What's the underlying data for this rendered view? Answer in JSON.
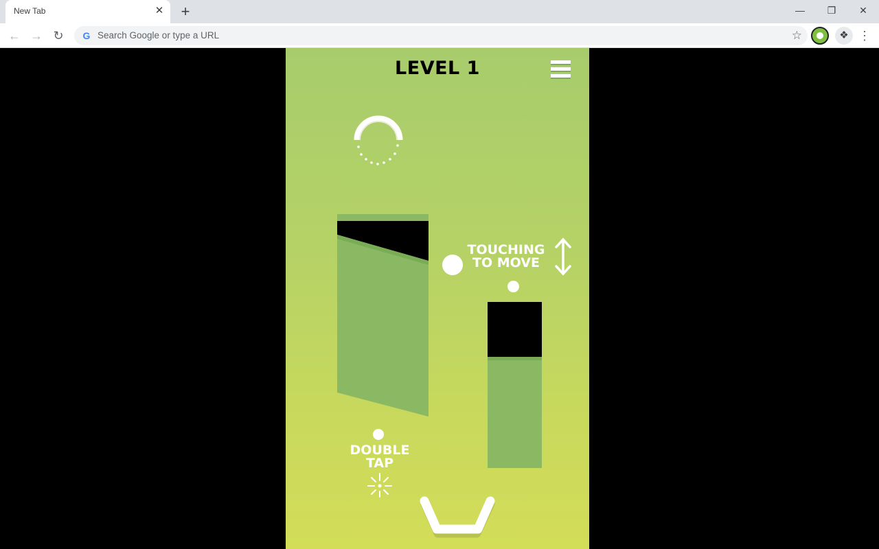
{
  "browser": {
    "tab_title": "New Tab",
    "tab_close": "✕",
    "new_tab": "+",
    "omnibox_placeholder": "Search Google or type a URL",
    "icons": [
      "back-icon",
      "forward-icon",
      "reload-icon",
      "google-icon",
      "star-icon",
      "extension-icon",
      "puzzle-icon",
      "menu-icon"
    ]
  },
  "game": {
    "level_title": "LEVEL 1",
    "hint_move_line1": "TOUCHING",
    "hint_move_line2": "TO MOVE",
    "hint_tap_line1": "DOUBLE",
    "hint_tap_line2": "TAP",
    "colors": {
      "bg_top": "#a8cc6c",
      "bg_bottom": "#d3dd58",
      "block": "#8bb862",
      "liquid": "#000000",
      "white": "#ffffff"
    }
  }
}
